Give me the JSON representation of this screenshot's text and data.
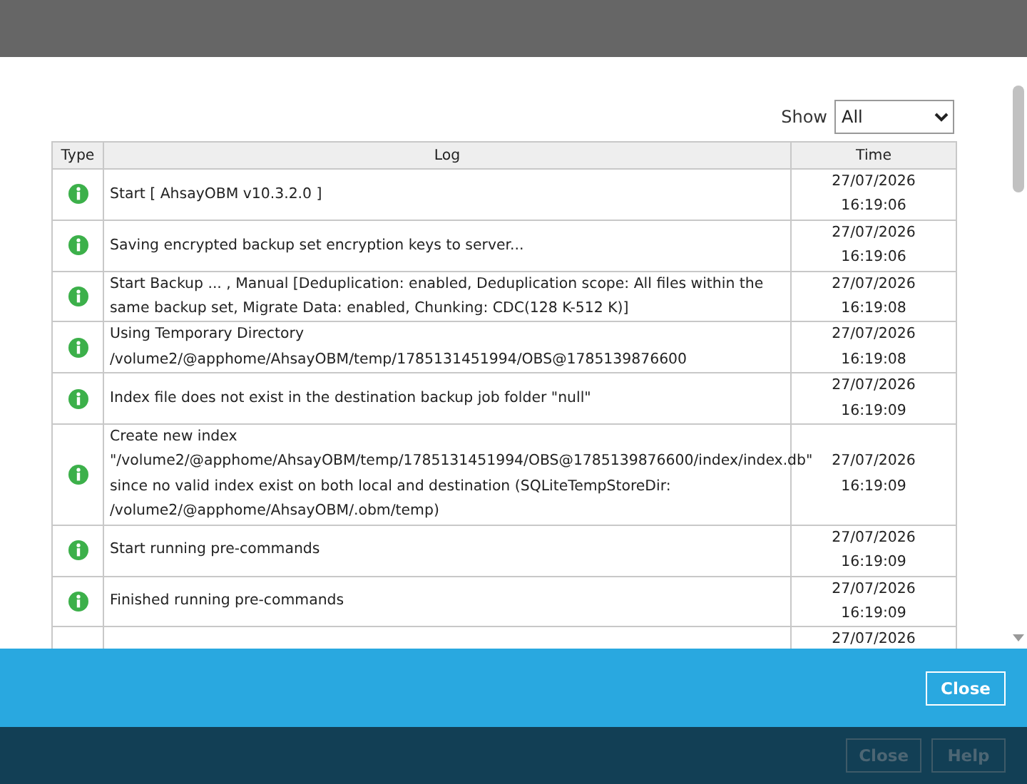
{
  "filter": {
    "label": "Show",
    "value": "All"
  },
  "table": {
    "columns": [
      "Type",
      "Log",
      "Time"
    ],
    "rows": [
      {
        "kind": "info",
        "log": "Start [ AhsayOBM v10.3.2.0 ]",
        "date": "27/07/2026",
        "time": "16:19:06"
      },
      {
        "kind": "info",
        "log": "Saving encrypted backup set encryption keys to server...",
        "date": "27/07/2026",
        "time": "16:19:06"
      },
      {
        "kind": "info",
        "log": "Start Backup ... , Manual [Deduplication: enabled, Deduplication scope: All files within the same backup set, Migrate Data: enabled, Chunking: CDC(128 K-512 K)]",
        "date": "27/07/2026",
        "time": "16:19:08"
      },
      {
        "kind": "info",
        "log": "Using Temporary Directory /volume2/@apphome/AhsayOBM/temp/1785131451994/OBS@1785139876600",
        "date": "27/07/2026",
        "time": "16:19:08"
      },
      {
        "kind": "info",
        "log": "Index file does not exist in the destination backup job folder \"null\"",
        "date": "27/07/2026",
        "time": "16:19:09"
      },
      {
        "kind": "info",
        "log": "Create new index \"/volume2/@apphome/AhsayOBM/temp/1785131451994/OBS@1785139876600/index/index.db\" since no valid index exist on both local and destination (SQLiteTempStoreDir: /volume2/@apphome/AhsayOBM/.obm/temp)",
        "date": "27/07/2026",
        "time": "16:19:09"
      },
      {
        "kind": "info",
        "log": "Start running pre-commands",
        "date": "27/07/2026",
        "time": "16:19:09"
      },
      {
        "kind": "info",
        "log": "Finished running pre-commands",
        "date": "27/07/2026",
        "time": "16:19:09"
      },
      {
        "date": "27/07/2026"
      }
    ]
  },
  "dialog_buttons": [
    {
      "label": "Close",
      "disabled": false
    }
  ],
  "footer_buttons": [
    {
      "label": "Close",
      "disabled": true
    },
    {
      "label": "Help",
      "disabled": true
    }
  ]
}
